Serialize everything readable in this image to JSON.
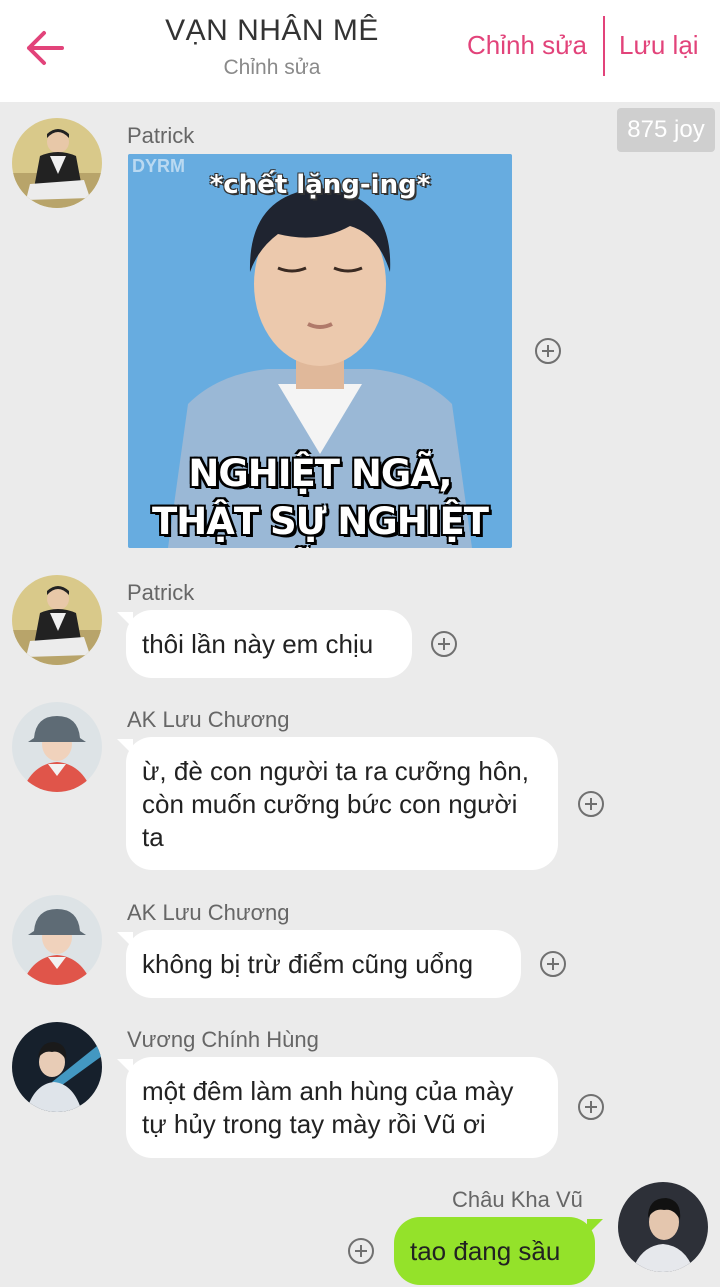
{
  "header": {
    "title": "VẠN NHÂN MÊ",
    "subtitle": "Chỉnh sửa",
    "edit_label": "Chỉnh sửa",
    "save_label": "Lưu lại"
  },
  "joy_badge": "875 joy",
  "colors": {
    "accent": "#e2437a",
    "bubble_self": "#94e22a",
    "bubble_other": "#ffffff",
    "background": "#ebebeb"
  },
  "messages": [
    {
      "sender": "Patrick",
      "type": "image",
      "image": {
        "watermark": "DYRM",
        "caption_top": "*chết lặng-ing*",
        "caption_bottom": "NGHIỆT NGÃ, THẬT SỰ NGHIỆT NGÃ!!!!!!"
      }
    },
    {
      "sender": "Patrick",
      "type": "text",
      "text": "thôi lần này em chịu"
    },
    {
      "sender": "AK Lưu Chương",
      "type": "text",
      "text": "ừ, đè con người ta ra cưỡng hôn, còn muốn cưỡng bức con người ta"
    },
    {
      "sender": "AK Lưu Chương",
      "type": "text",
      "text": "không bị trừ điểm cũng uổng"
    },
    {
      "sender": "Vương Chính Hùng",
      "type": "text",
      "text": "một đêm làm anh hùng của mày tự hủy trong tay mày rồi Vũ ơi"
    },
    {
      "sender": "Châu Kha Vũ",
      "type": "text",
      "self": true,
      "text": "tao đang sầu"
    }
  ]
}
